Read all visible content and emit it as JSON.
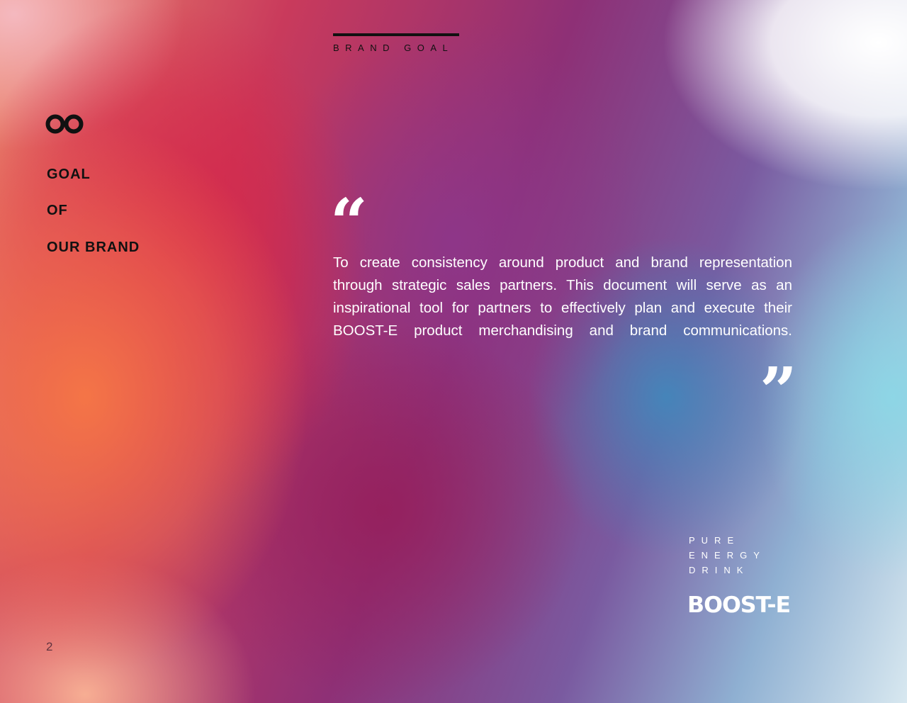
{
  "header": {
    "label": "BRAND GOAL"
  },
  "sidebar": {
    "logo_icon": "infinity-icon",
    "lines": [
      "GOAL",
      "OF",
      "OUR BRAND"
    ]
  },
  "quote": {
    "open_mark": "“",
    "close_mark": "”",
    "text": "To create consistency around product and brand representation through strategic sales partners. This document will serve as an inspirational tool for partners to effectively plan and execute their BOOST-E product merchandising and brand communications."
  },
  "brand": {
    "tagline": [
      "PURE",
      "ENERGY",
      "DRINK"
    ],
    "wordmark": "BOOST-E"
  },
  "footer": {
    "page_number": "2"
  },
  "colors": {
    "text_dark": "#111111",
    "text_light": "#ffffff",
    "gradient_red": "#d62648",
    "gradient_orange": "#f67846",
    "gradient_purple": "#8c378c",
    "gradient_blue": "#3c8cbe",
    "gradient_cyan": "#8cd7e6"
  }
}
